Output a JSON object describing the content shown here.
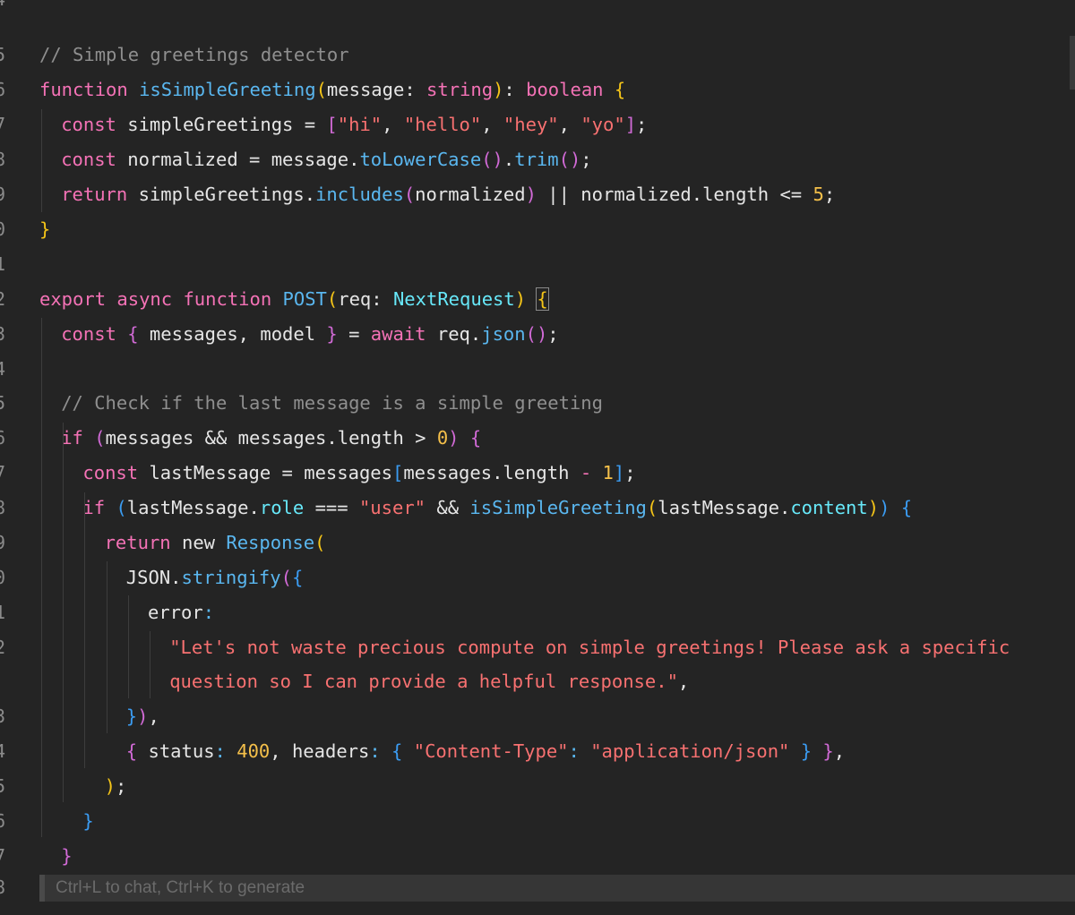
{
  "editor": {
    "line_numbers": [
      "4",
      "5",
      "6",
      "7",
      "8",
      "9",
      "0",
      "1",
      "2",
      "3",
      "4",
      "5",
      "6",
      "7",
      "8",
      "9",
      "0",
      "1",
      "2",
      "",
      "3",
      "4",
      "5",
      "6",
      "7",
      "8"
    ],
    "hint": "Ctrl+L to chat, Ctrl+K to generate",
    "lines": [
      [],
      [
        [
          "com",
          "// Simple greetings detector"
        ]
      ],
      [
        [
          "kw",
          "function "
        ],
        [
          "fn",
          "isSimpleGreeting"
        ],
        [
          "b1",
          "("
        ],
        [
          "plain",
          "message: "
        ],
        [
          "kw",
          "string"
        ],
        [
          "b1",
          ")"
        ],
        [
          "plain",
          ": "
        ],
        [
          "kw",
          "boolean "
        ],
        [
          "b1",
          "{"
        ]
      ],
      [
        [
          "kw",
          "const "
        ],
        [
          "plain",
          "simpleGreetings = "
        ],
        [
          "b2",
          "["
        ],
        [
          "str",
          "\"hi\""
        ],
        [
          "plain",
          ", "
        ],
        [
          "str",
          "\"hello\""
        ],
        [
          "plain",
          ", "
        ],
        [
          "str",
          "\"hey\""
        ],
        [
          "plain",
          ", "
        ],
        [
          "str",
          "\"yo\""
        ],
        [
          "b2",
          "]"
        ],
        [
          "plain",
          ";"
        ]
      ],
      [
        [
          "kw",
          "const "
        ],
        [
          "plain",
          "normalized = message."
        ],
        [
          "fn",
          "toLowerCase"
        ],
        [
          "b2",
          "()"
        ],
        [
          "plain",
          "."
        ],
        [
          "fn",
          "trim"
        ],
        [
          "b2",
          "()"
        ],
        [
          "plain",
          ";"
        ]
      ],
      [
        [
          "kw",
          "return "
        ],
        [
          "plain",
          "simpleGreetings."
        ],
        [
          "fn",
          "includes"
        ],
        [
          "b2",
          "("
        ],
        [
          "plain",
          "normalized"
        ],
        [
          "b2",
          ")"
        ],
        [
          "plain",
          " || normalized.length <= "
        ],
        [
          "num",
          "5"
        ],
        [
          "plain",
          ";"
        ]
      ],
      [
        [
          "b1",
          "}"
        ]
      ],
      [],
      [
        [
          "kw",
          "export async function "
        ],
        [
          "fn",
          "POST"
        ],
        [
          "b1",
          "("
        ],
        [
          "plain",
          "req: "
        ],
        [
          "type",
          "NextRequest"
        ],
        [
          "b1",
          ")"
        ],
        [
          "plain",
          " "
        ],
        [
          "b1m",
          "{"
        ]
      ],
      [
        [
          "kw",
          "const "
        ],
        [
          "b2",
          "{"
        ],
        [
          "plain",
          " messages, model "
        ],
        [
          "b2",
          "}"
        ],
        [
          "plain",
          " = "
        ],
        [
          "kw",
          "await "
        ],
        [
          "plain",
          "req."
        ],
        [
          "fn",
          "json"
        ],
        [
          "b2",
          "()"
        ],
        [
          "plain",
          ";"
        ]
      ],
      [],
      [
        [
          "com",
          "// Check if the last message is a simple greeting"
        ]
      ],
      [
        [
          "kw",
          "if "
        ],
        [
          "b2",
          "("
        ],
        [
          "plain",
          "messages && messages.length > "
        ],
        [
          "num",
          "0"
        ],
        [
          "b2",
          ")"
        ],
        [
          "plain",
          " "
        ],
        [
          "b2",
          "{"
        ]
      ],
      [
        [
          "kw",
          "const "
        ],
        [
          "plain",
          "lastMessage = messages"
        ],
        [
          "b3",
          "["
        ],
        [
          "plain",
          "messages.length "
        ],
        [
          "kw",
          "- "
        ],
        [
          "num",
          "1"
        ],
        [
          "b3",
          "]"
        ],
        [
          "plain",
          ";"
        ]
      ],
      [
        [
          "kw",
          "if "
        ],
        [
          "b3",
          "("
        ],
        [
          "plain",
          "lastMessage."
        ],
        [
          "prop",
          "role"
        ],
        [
          "plain",
          " === "
        ],
        [
          "str",
          "\"user\""
        ],
        [
          "plain",
          " && "
        ],
        [
          "fn",
          "isSimpleGreeting"
        ],
        [
          "b1",
          "("
        ],
        [
          "plain",
          "lastMessage."
        ],
        [
          "prop",
          "content"
        ],
        [
          "b1",
          ")"
        ],
        [
          "b3",
          ")"
        ],
        [
          "plain",
          " "
        ],
        [
          "b3",
          "{"
        ]
      ],
      [
        [
          "kw",
          "return "
        ],
        [
          "plain",
          "new "
        ],
        [
          "fn",
          "Response"
        ],
        [
          "b1",
          "("
        ]
      ],
      [
        [
          "plain",
          "JSON."
        ],
        [
          "fn",
          "stringify"
        ],
        [
          "b2",
          "("
        ],
        [
          "b3",
          "{"
        ]
      ],
      [
        [
          "plain",
          "error"
        ],
        [
          "fn",
          ":"
        ]
      ],
      [
        [
          "str",
          "\"Let's not waste precious compute on simple greetings! Please ask a specific"
        ]
      ],
      [
        [
          "str",
          "question so I can provide a helpful response.\""
        ],
        [
          "plain",
          ","
        ]
      ],
      [
        [
          "b3",
          "}"
        ],
        [
          "b2",
          ")"
        ],
        [
          "plain",
          ","
        ]
      ],
      [
        [
          "b2",
          "{"
        ],
        [
          "plain",
          " status"
        ],
        [
          "fn",
          ":"
        ],
        [
          "plain",
          " "
        ],
        [
          "num",
          "400"
        ],
        [
          "plain",
          ", headers"
        ],
        [
          "fn",
          ":"
        ],
        [
          "plain",
          " "
        ],
        [
          "b3",
          "{"
        ],
        [
          "plain",
          " "
        ],
        [
          "str",
          "\"Content-Type\""
        ],
        [
          "fn",
          ":"
        ],
        [
          "plain",
          " "
        ],
        [
          "str",
          "\"application/json\""
        ],
        [
          "plain",
          " "
        ],
        [
          "b3",
          "}"
        ],
        [
          "plain",
          " "
        ],
        [
          "b2",
          "}"
        ],
        [
          "plain",
          ","
        ]
      ],
      [
        [
          "b1",
          ")"
        ],
        [
          "plain",
          ";"
        ]
      ],
      [
        [
          "b3",
          "}"
        ]
      ],
      [
        [
          "b2",
          "}"
        ]
      ],
      []
    ]
  },
  "colors": {
    "background": "#242424",
    "keyword": "#f472b6",
    "function": "#5ab7f0",
    "string": "#f87171",
    "comment": "#8f8f8f",
    "number": "#f5c04a"
  }
}
